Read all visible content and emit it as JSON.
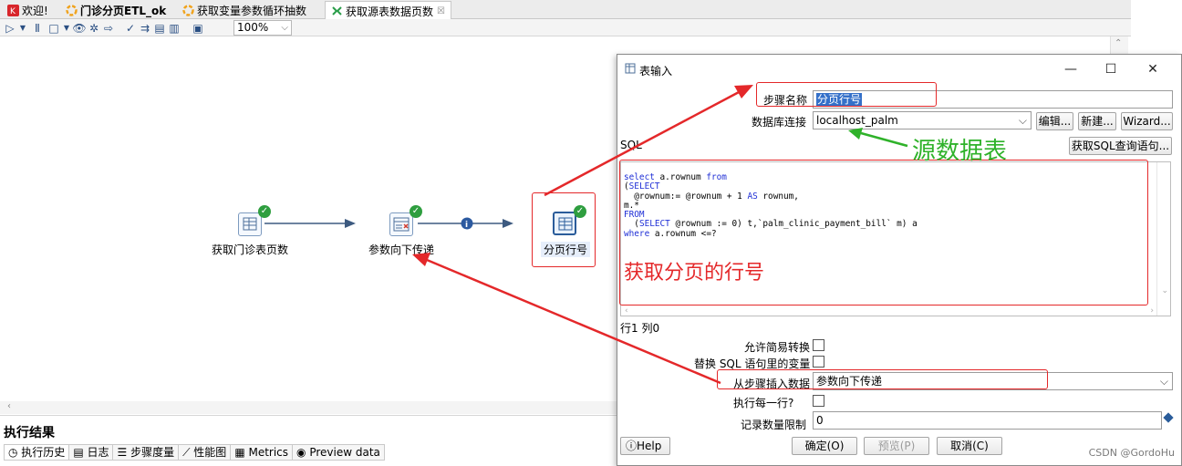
{
  "tabs": [
    {
      "label": "欢迎!",
      "icon": "welcome-icon"
    },
    {
      "label": "门诊分页ETL_ok",
      "icon": "job-icon"
    },
    {
      "label": "获取变量参数循环抽数",
      "icon": "job-icon"
    },
    {
      "label": "获取源表数据页数",
      "icon": "transformation-icon",
      "close": "☒"
    }
  ],
  "toolbar": {
    "zoom": "100%"
  },
  "canvas": {
    "steps": [
      {
        "label": "获取门诊表页数",
        "icon": "table-input-icon"
      },
      {
        "label": "参数向下传递",
        "icon": "set-variables-icon"
      },
      {
        "label": "分页行号",
        "icon": "table-input-icon"
      }
    ],
    "hop_info": "i"
  },
  "results": {
    "title": "执行结果",
    "tabs": [
      "执行历史",
      "日志",
      "步骤度量",
      "性能图",
      "Metrics",
      "Preview data"
    ]
  },
  "dialog": {
    "title": "表输入",
    "step_name_label": "步骤名称",
    "step_name_value": "分页行号",
    "db_conn_label": "数据库连接",
    "db_conn_value": "localhost_palm",
    "edit_button": "编辑...",
    "new_button": "新建...",
    "wizard_button": "Wizard...",
    "sql_label": "SQL",
    "get_sql_button": "获取SQL查询语句...",
    "sql_lines": [
      "select a.rownum from",
      "(SELECT",
      "  @rownum:= @rownum + 1 AS rownum,",
      "m.*",
      "FROM",
      "  (SELECT @rownum := 0) t,`palm_clinic_payment_bill` m) a",
      "where a.rownum <=?"
    ],
    "cursor_pos": "行1 列0",
    "lazy_conversion_label": "允许简易转换",
    "replace_vars_label": "替换 SQL 语句里的变量",
    "insert_from_step_label": "从步骤插入数据",
    "insert_from_step_value": "参数向下传递",
    "execute_each_row_label": "执行每一行?",
    "limit_label": "记录数量限制",
    "limit_value": "0",
    "help_button": "Help",
    "ok_button": "确定(O)",
    "preview_button": "预览(P)",
    "cancel_button": "取消(C)"
  },
  "annotations": {
    "source_table": "源数据表",
    "get_row_number": "获取分页的行号"
  },
  "watermark": "CSDN @GordoHu",
  "colors": {
    "annotation_red": "#e4282a",
    "annotation_green": "#2fb22a",
    "sql_keyword": "#1f2fd6",
    "selection": "#3470c9"
  }
}
